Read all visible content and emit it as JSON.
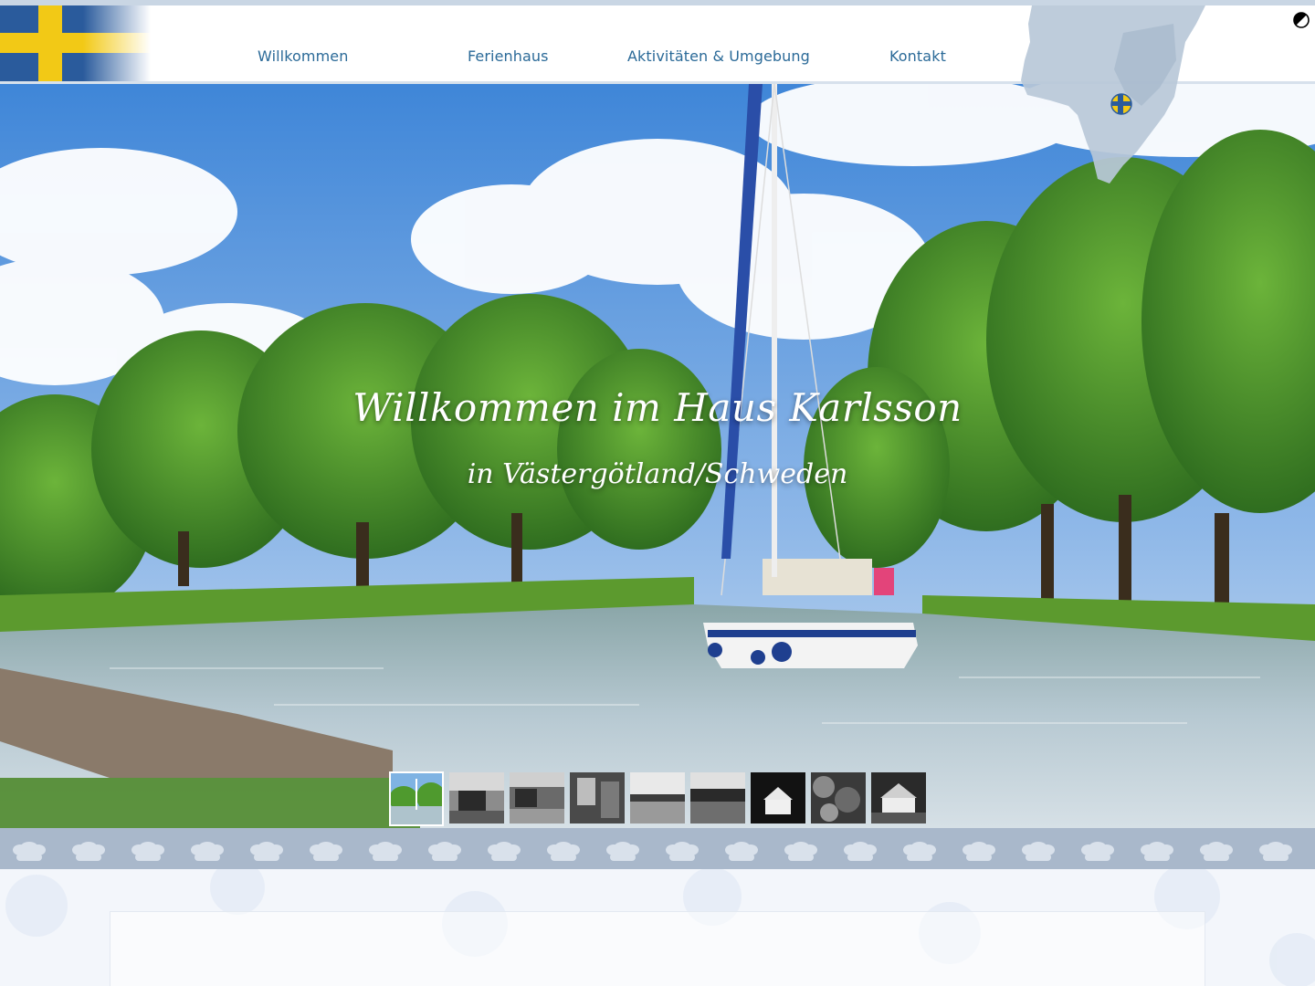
{
  "nav": {
    "items": [
      {
        "label": "Willkommen"
      },
      {
        "label": "Ferienhaus"
      },
      {
        "label": "Aktivitäten & Umgebung"
      },
      {
        "label": "Kontakt"
      }
    ]
  },
  "hero": {
    "title": "Willkommen im Haus Karlsson",
    "subtitle": "in Västergötland/Schweden"
  },
  "gallery": {
    "active_index": 0,
    "thumbnails": [
      {
        "name": "canal-sailboat"
      },
      {
        "name": "red-house-lake"
      },
      {
        "name": "garden-house"
      },
      {
        "name": "porch"
      },
      {
        "name": "lakeside"
      },
      {
        "name": "lake-forest"
      },
      {
        "name": "white-house-night"
      },
      {
        "name": "forest-path"
      },
      {
        "name": "house-front"
      }
    ]
  },
  "icons": {
    "contrast_toggle": "contrast-icon",
    "flag": "swedish-flag",
    "map": "sweden-map"
  },
  "colors": {
    "nav_text": "#2b6a98",
    "flag_blue": "#2a5b9c",
    "flag_yellow": "#f2c916",
    "ornament_band": "#a9b8cb",
    "map": "#b9c8d8"
  }
}
